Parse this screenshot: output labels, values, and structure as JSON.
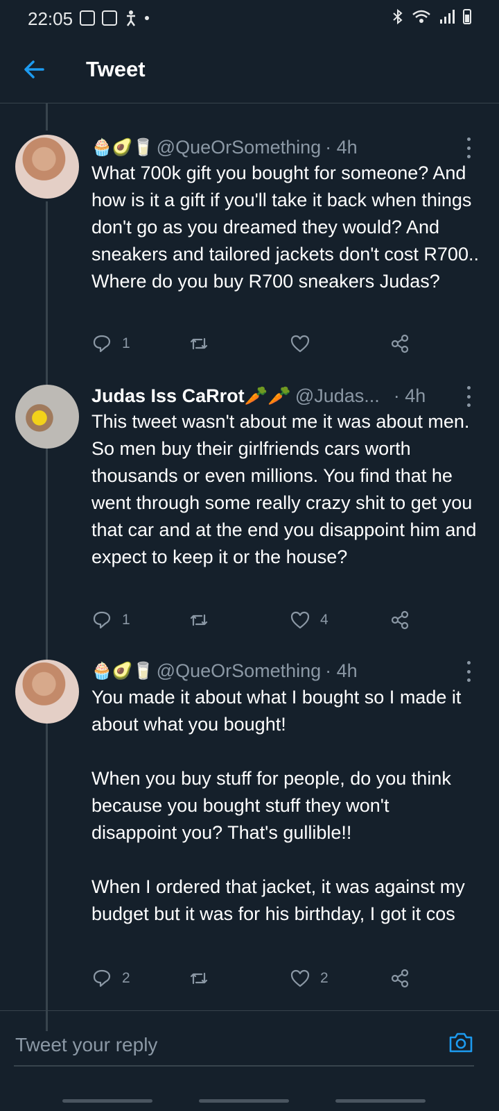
{
  "status_bar": {
    "time": "22:05",
    "left_icons": [
      "image-icon",
      "play-store-icon",
      "accessibility-icon",
      "notification-dot-icon"
    ],
    "right_icons": [
      "bluetooth-icon",
      "wifi-icon",
      "signal-icon",
      "battery-icon"
    ]
  },
  "header": {
    "title": "Tweet"
  },
  "tweets": [
    {
      "emojis": "🧁🥑🥛",
      "display_name": "",
      "handle": "@QueOrSomething",
      "time": "· 4h",
      "text": "What 700k gift you bought for someone? And how is it a gift if you'll take it back when things don't go as you dreamed they would? And sneakers and tailored jackets don't cost R700.. Where do you buy R700 sneakers Judas?",
      "reply_count": "1",
      "retweet_count": "",
      "like_count": ""
    },
    {
      "emojis": "",
      "display_name": "Judas Iss CaRrot🥕🥕",
      "handle": "@Judas...",
      "time": "· 4h",
      "text": "This tweet wasn't about me it was about men. So men buy their girlfriends cars worth thousands or even millions. You find that he went through some really crazy shit to get you that car and at the end you disappoint him and expect to keep it or the house?",
      "reply_count": "1",
      "retweet_count": "",
      "like_count": "4"
    },
    {
      "emojis": "🧁🥑🥛",
      "display_name": "",
      "handle": "@QueOrSomething",
      "time": "· 4h",
      "text": "You made it about what I bought so I made it about what you bought!\n\nWhen you buy stuff for people, do you think because you bought stuff they won't disappoint you? That's gullible!!\n\nWhen I ordered that jacket, it was against my budget but it was for his birthday, I got it cos",
      "reply_count": "2",
      "retweet_count": "",
      "like_count": "2"
    }
  ],
  "reply_box": {
    "placeholder": "Tweet your reply"
  },
  "colors": {
    "background": "#15202b",
    "accent": "#1d9bf0",
    "muted": "#8b98a5",
    "divider": "#38444d"
  }
}
